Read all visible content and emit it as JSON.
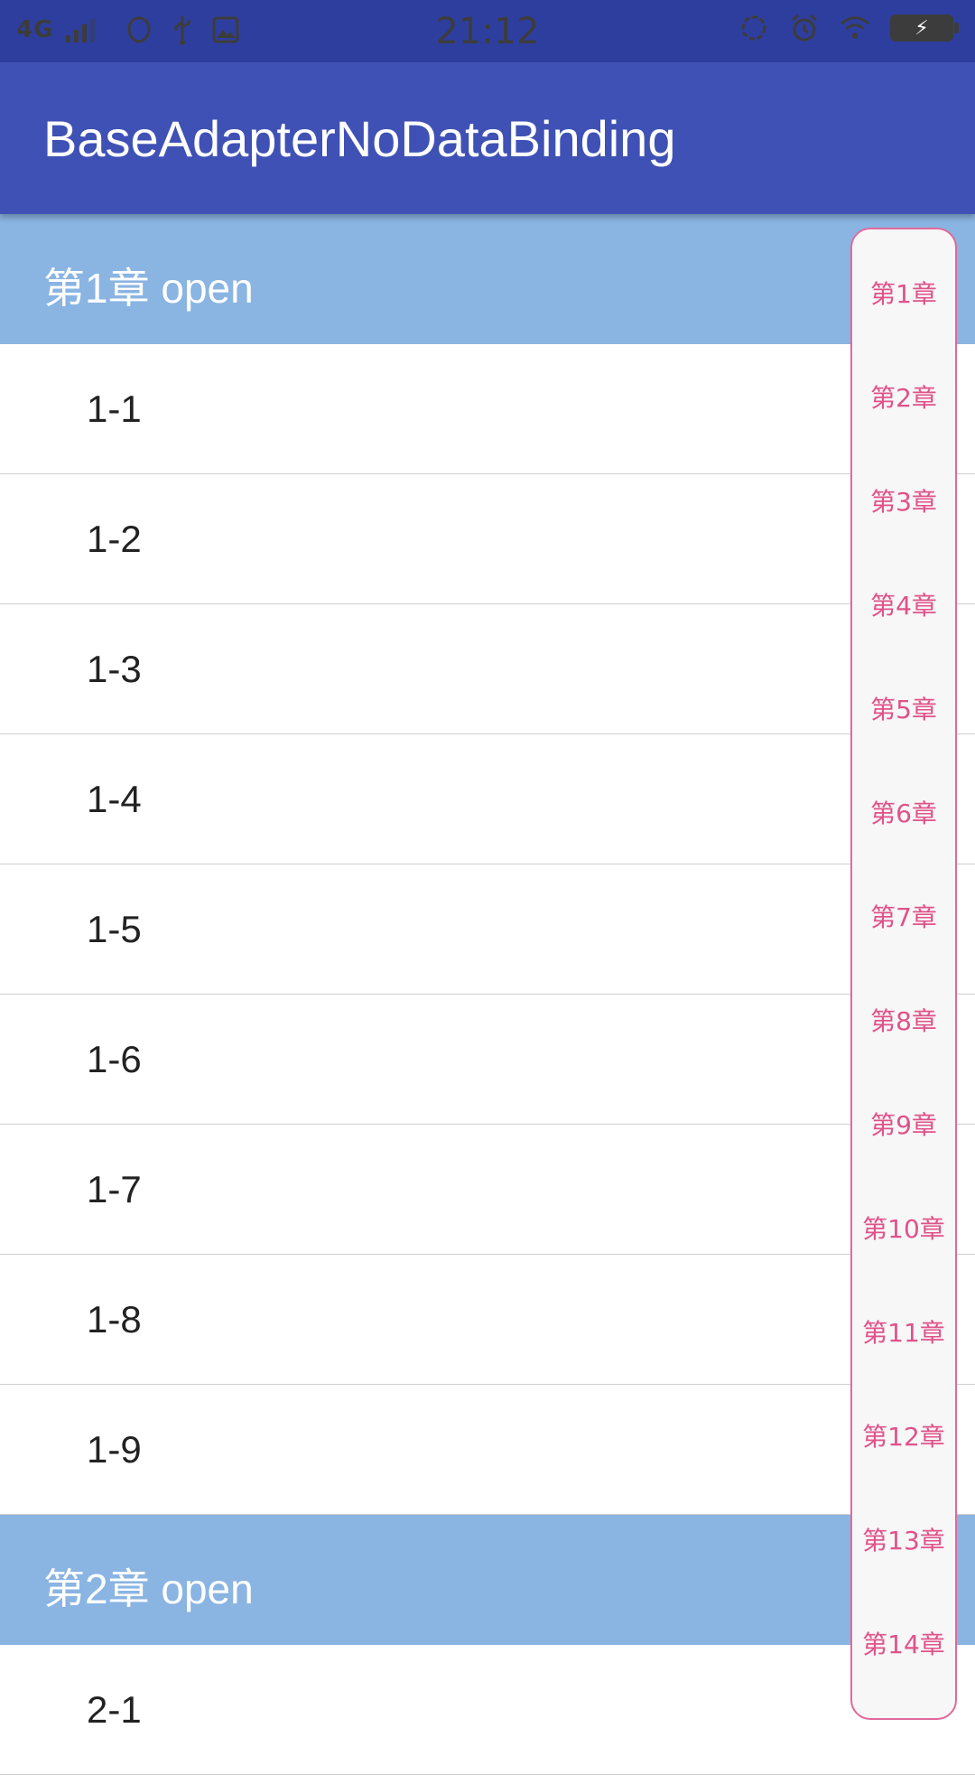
{
  "status_bar": {
    "network": "4G",
    "time": "21:12",
    "battery_icon": "battery-charging-icon",
    "icons_left": [
      "signal-icon",
      "notification-icon",
      "usb-icon",
      "image-icon"
    ],
    "icons_right": [
      "sync-icon",
      "alarm-icon",
      "wifi-icon",
      "battery-charging-icon"
    ]
  },
  "app_bar": {
    "title": "BaseAdapterNoDataBinding"
  },
  "sections": [
    {
      "title": "第1章 open",
      "items": [
        "1-1",
        "1-2",
        "1-3",
        "1-4",
        "1-5",
        "1-6",
        "1-7",
        "1-8",
        "1-9"
      ]
    },
    {
      "title": "第2章 open",
      "items": [
        "2-1"
      ]
    }
  ],
  "index_bar": {
    "items": [
      "第1章",
      "第2章",
      "第3章",
      "第4章",
      "第5章",
      "第6章",
      "第7章",
      "第8章",
      "第9章",
      "第10章",
      "第11章",
      "第12章",
      "第13章",
      "第14章"
    ],
    "accent_color": "#e0528a",
    "border_color": "#e06a9a"
  },
  "colors": {
    "primary": "#3f51b5",
    "status_bar": "#2e3e9e",
    "section_header": "#8ab4e2"
  }
}
